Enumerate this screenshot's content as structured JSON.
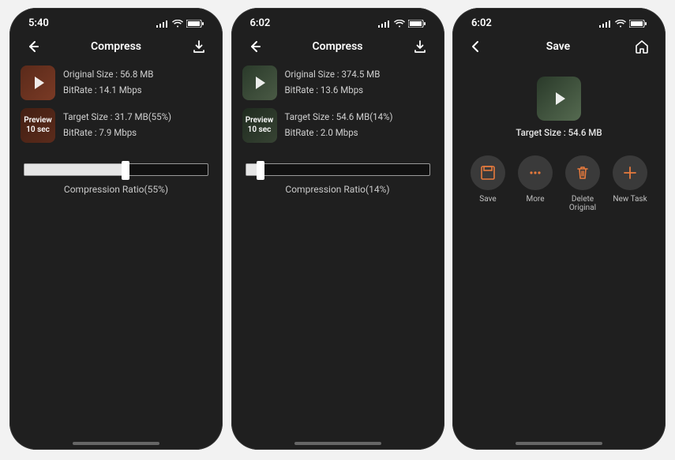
{
  "screens": [
    {
      "time": "5:40",
      "title": "Compress",
      "leftIcon": "back",
      "rightIcon": "download",
      "original": {
        "sizeLabel": "Original Size : 56.8 MB",
        "bitrateLabel": "BitRate : 14.1 Mbps"
      },
      "target": {
        "sizeLabel": "Target Size : 31.7 MB(55%)",
        "bitrateLabel": "BitRate : 7.9 Mbps"
      },
      "preview": {
        "line1": "Preview",
        "line2": "10 sec"
      },
      "ratioLabel": "Compression Ratio(55%)",
      "fillPercent": 55
    },
    {
      "time": "6:02",
      "title": "Compress",
      "leftIcon": "back",
      "rightIcon": "download",
      "original": {
        "sizeLabel": "Original Size : 374.5 MB",
        "bitrateLabel": "BitRate : 13.6 Mbps"
      },
      "target": {
        "sizeLabel": "Target Size : 54.6 MB(14%)",
        "bitrateLabel": "BitRate : 2.0 Mbps"
      },
      "preview": {
        "line1": "Preview",
        "line2": "10 sec"
      },
      "ratioLabel": "Compression Ratio(14%)",
      "fillPercent": 14
    },
    {
      "time": "6:02",
      "title": "Save",
      "leftIcon": "chevron-back",
      "rightIcon": "home",
      "saveCaption": "Target Size : 54.6 MB",
      "actions": [
        {
          "name": "save",
          "label": "Save"
        },
        {
          "name": "more",
          "label": "More"
        },
        {
          "name": "delete",
          "label": "Delete Original"
        },
        {
          "name": "newtask",
          "label": "New Task"
        }
      ]
    }
  ]
}
